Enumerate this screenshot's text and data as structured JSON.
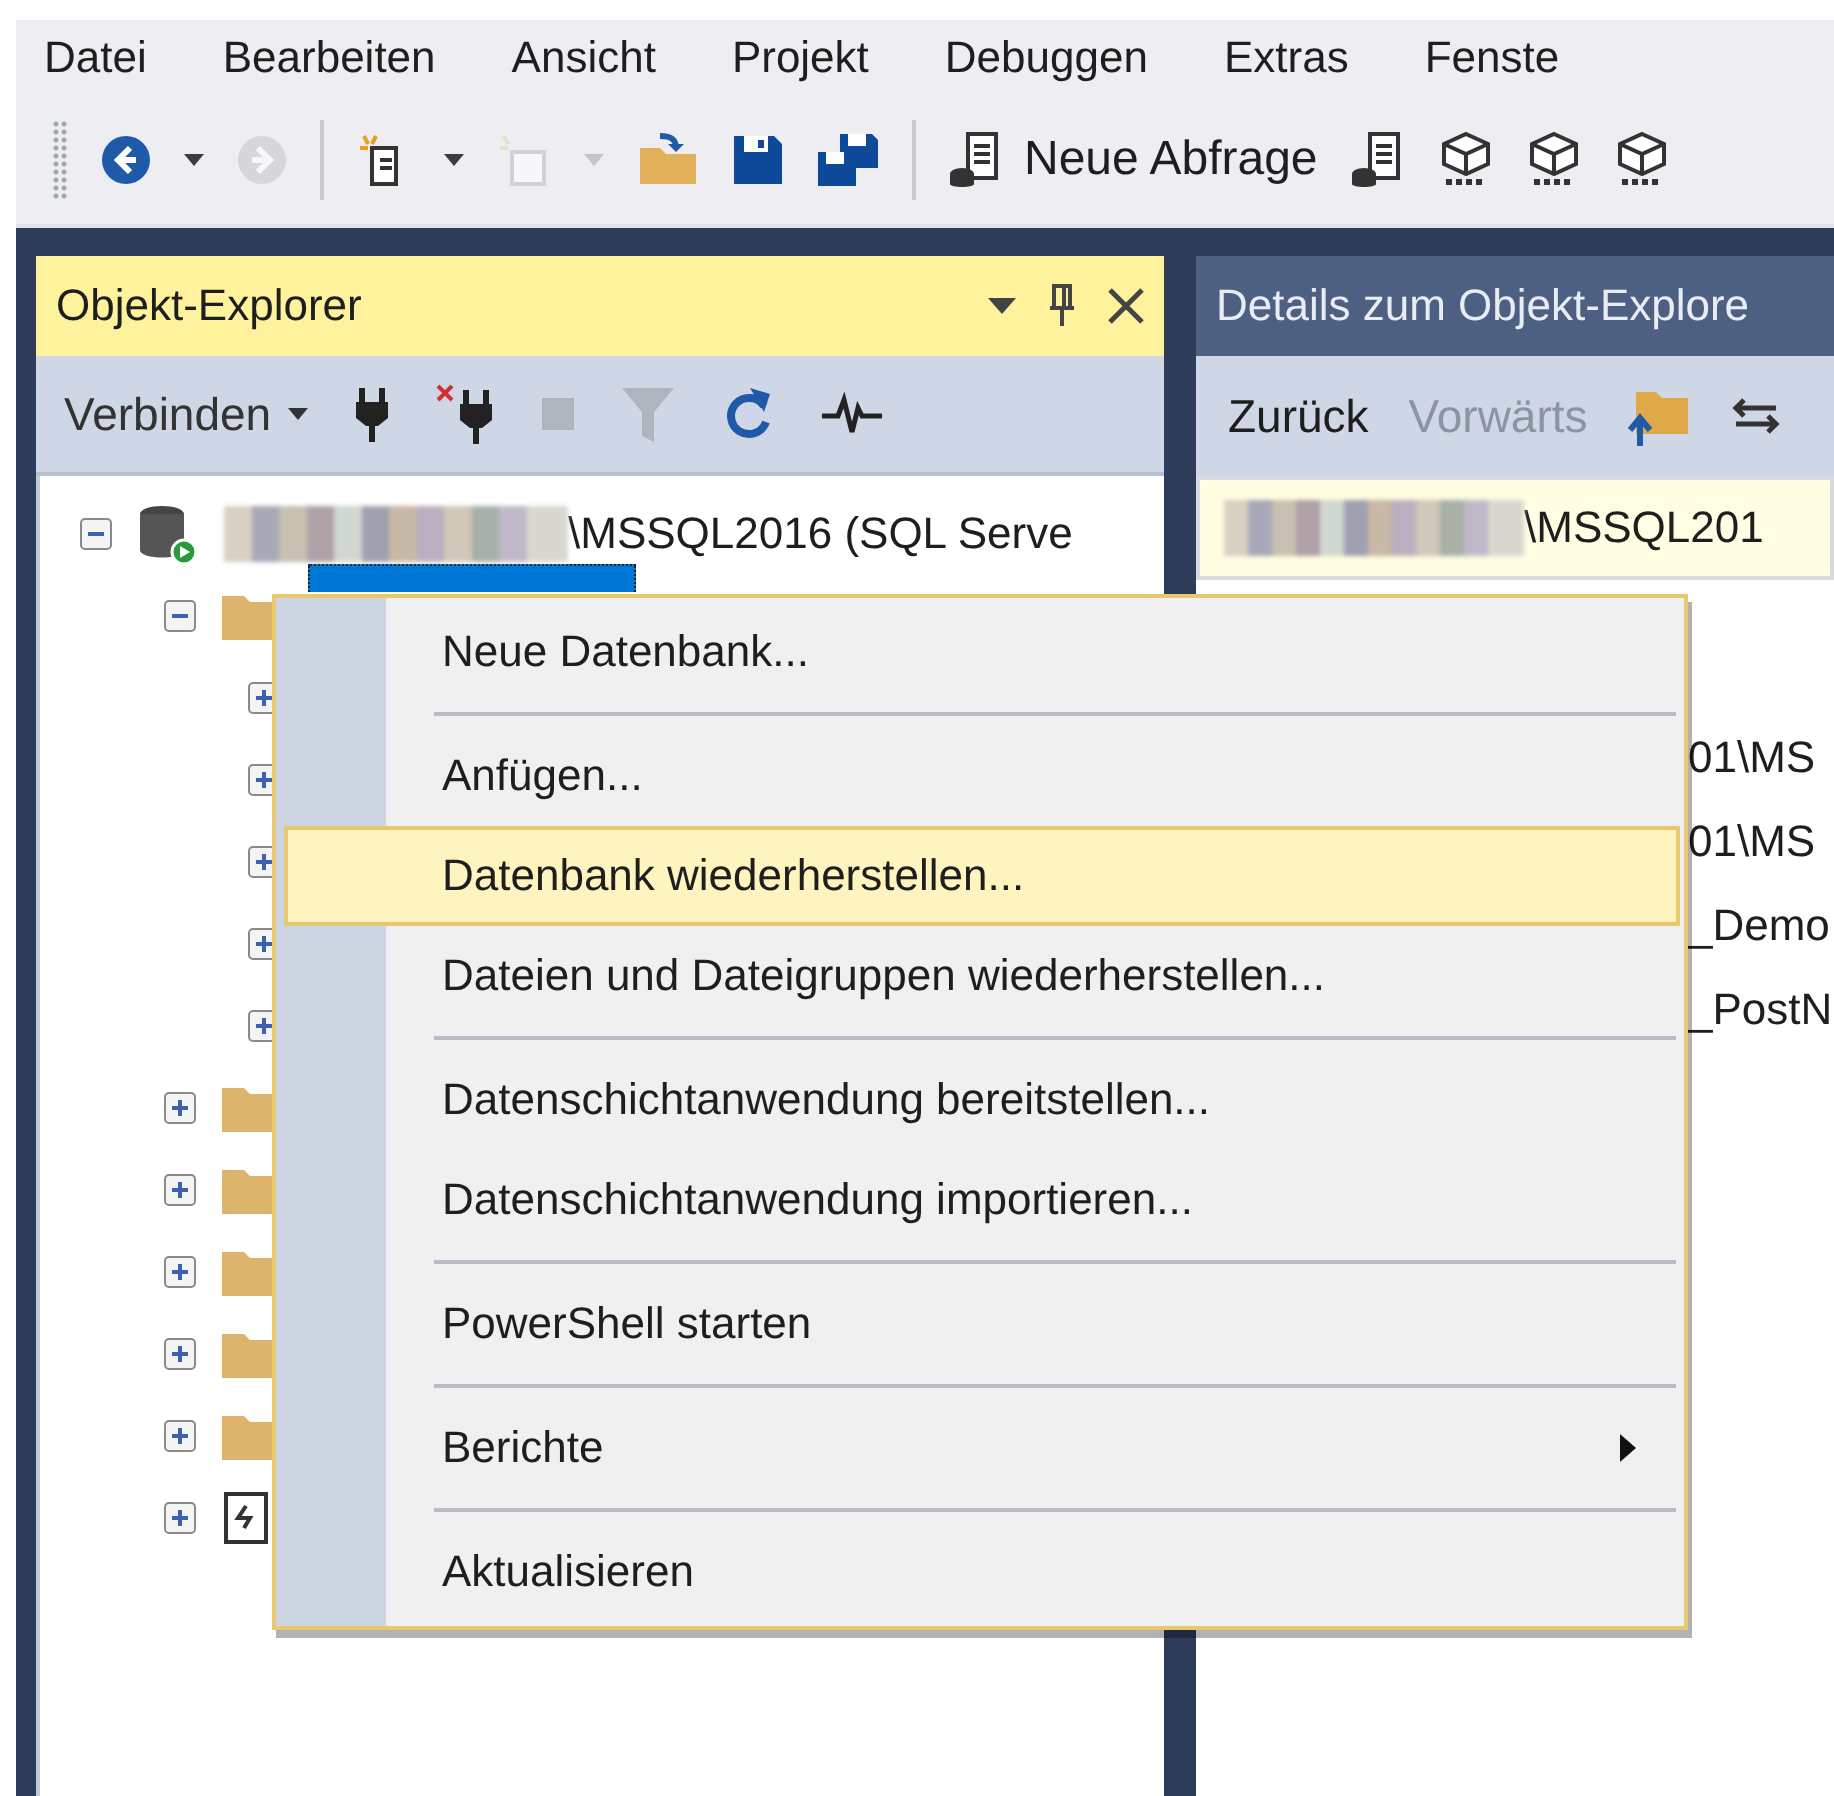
{
  "menu_bar": {
    "items": [
      "Datei",
      "Bearbeiten",
      "Ansicht",
      "Projekt",
      "Debuggen",
      "Extras",
      "Fenste"
    ]
  },
  "toolbar": {
    "buttons": [
      {
        "kind": "back",
        "disabled": false
      },
      {
        "kind": "caret",
        "disabled": false
      },
      {
        "kind": "forward",
        "disabled": true
      },
      {
        "kind": "separator"
      },
      {
        "kind": "new-project",
        "disabled": false
      },
      {
        "kind": "caret",
        "disabled": false
      },
      {
        "kind": "add-item",
        "disabled": true
      },
      {
        "kind": "caret",
        "disabled": true
      },
      {
        "kind": "open",
        "disabled": false
      },
      {
        "kind": "save",
        "disabled": false
      },
      {
        "kind": "save-all",
        "disabled": false
      },
      {
        "kind": "separator"
      },
      {
        "kind": "new-query",
        "label": "Neue Abfrage",
        "disabled": false
      },
      {
        "kind": "query-doc",
        "disabled": false
      },
      {
        "kind": "cube",
        "disabled": false
      },
      {
        "kind": "cube",
        "disabled": false
      },
      {
        "kind": "cube",
        "disabled": false
      }
    ]
  },
  "object_explorer": {
    "title": "Objekt-Explorer",
    "toolbar": {
      "connect_label": "Verbinden",
      "buttons": [
        {
          "kind": "plug",
          "disabled": false
        },
        {
          "kind": "unplug",
          "disabled": false
        },
        {
          "kind": "stop",
          "disabled": true
        },
        {
          "kind": "filter",
          "disabled": true
        },
        {
          "kind": "refresh",
          "disabled": false
        },
        {
          "kind": "activity",
          "disabled": false
        }
      ]
    },
    "tree": [
      {
        "kind": "server",
        "label": "\\MSSQL2016 (SQL Serve",
        "redacted": true,
        "expanded": true,
        "selected": false,
        "children": [
          {
            "kind": "folder",
            "selected": true,
            "expanded": true,
            "children": [
              {
                "expanded": false
              },
              {
                "expanded": false
              },
              {
                "expanded": false
              },
              {
                "expanded": false
              },
              {
                "expanded": false
              }
            ]
          },
          {
            "kind": "folder",
            "expanded": false
          },
          {
            "kind": "folder",
            "expanded": false
          },
          {
            "kind": "folder",
            "expanded": false
          },
          {
            "kind": "folder",
            "expanded": false
          },
          {
            "kind": "folder",
            "expanded": false
          },
          {
            "kind": "log",
            "expanded": false
          }
        ]
      }
    ]
  },
  "details": {
    "title": "Details zum Objekt-Explore",
    "back_label": "Zurück",
    "forward_label": "Vorwärts",
    "forward_disabled": true,
    "path": "\\MSSQL201",
    "rows": [
      "01\\MS",
      "01\\MS",
      "_Demo",
      "_PostN"
    ]
  },
  "context_menu": {
    "items": [
      {
        "kind": "item",
        "label": "Neue Datenbank...",
        "selected": false
      },
      {
        "kind": "separator"
      },
      {
        "kind": "item",
        "label": "Anfügen...",
        "selected": false
      },
      {
        "kind": "item",
        "label": "Datenbank wiederherstellen...",
        "selected": true
      },
      {
        "kind": "item",
        "label": "Dateien und Dateigruppen wiederherstellen...",
        "selected": false
      },
      {
        "kind": "separator"
      },
      {
        "kind": "item",
        "label": "Datenschichtanwendung bereitstellen...",
        "selected": false
      },
      {
        "kind": "item",
        "label": "Datenschichtanwendung importieren...",
        "selected": false
      },
      {
        "kind": "separator"
      },
      {
        "kind": "item",
        "label": "PowerShell starten",
        "selected": false
      },
      {
        "kind": "separator"
      },
      {
        "kind": "submenu",
        "label": "Berichte",
        "selected": false
      },
      {
        "kind": "separator"
      },
      {
        "kind": "item",
        "label": "Aktualisieren",
        "selected": false
      }
    ]
  }
}
